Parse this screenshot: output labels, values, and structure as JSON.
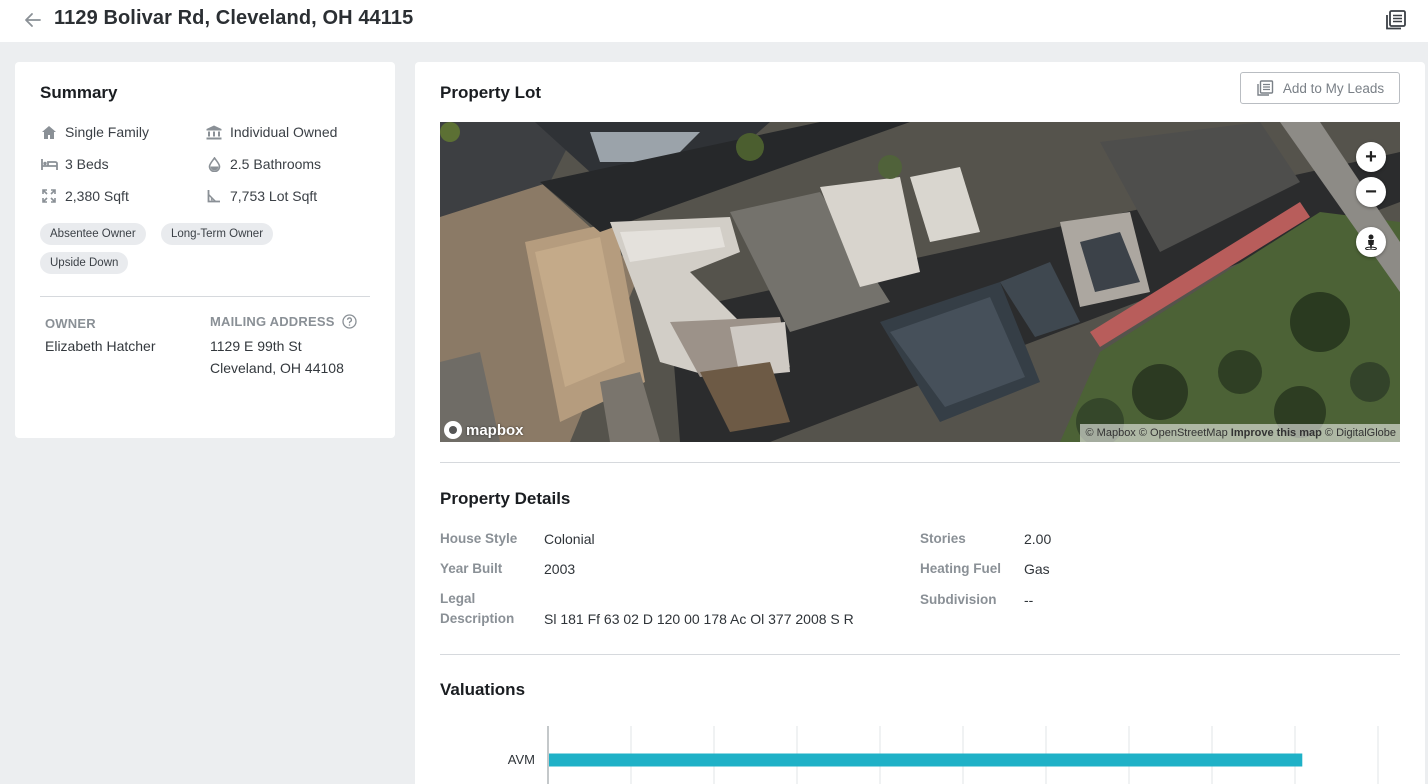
{
  "header": {
    "title": "1129 Bolivar Rd, Cleveland, OH 44115"
  },
  "summary": {
    "title": "Summary",
    "features": [
      {
        "icon": "home-icon",
        "label": "Single Family"
      },
      {
        "icon": "bank-icon",
        "label": "Individual Owned"
      },
      {
        "icon": "bed-icon",
        "label": "3 Beds"
      },
      {
        "icon": "water-drop-icon",
        "label": "2.5 Bathrooms"
      },
      {
        "icon": "expand-icon",
        "label": "2,380 Sqft"
      },
      {
        "icon": "lot-angle-icon",
        "label": "7,753 Lot Sqft"
      }
    ],
    "tags": [
      "Absentee Owner",
      "Long-Term Owner",
      "Upside Down"
    ],
    "owner_label": "OWNER",
    "owner_name": "Elizabeth Hatcher",
    "mailing_label": "MAILING ADDRESS",
    "mailing_line1": "1129 E 99th St",
    "mailing_line2": "Cleveland, OH 44108"
  },
  "property_lot": {
    "title": "Property Lot",
    "add_leads_label": "Add to My Leads",
    "map": {
      "brand": "mapbox",
      "attribution_mapbox": "© Mapbox",
      "attribution_osm": "© OpenStreetMap",
      "attribution_improve": "Improve this map",
      "attribution_dg": "© DigitalGlobe",
      "zoom_in": "+",
      "zoom_out": "−"
    }
  },
  "property_details": {
    "title": "Property Details",
    "left": [
      {
        "label": "House Style",
        "value": "Colonial"
      },
      {
        "label": "Year Built",
        "value": "2003"
      },
      {
        "label": "Legal Description",
        "value": "Sl 181 Ff 63 02 D 120 00 178 Ac Ol 377 2008 S R"
      }
    ],
    "right": [
      {
        "label": "Stories",
        "value": "2.00"
      },
      {
        "label": "Heating Fuel",
        "value": "Gas"
      },
      {
        "label": "Subdivision",
        "value": "--"
      }
    ]
  },
  "valuations": {
    "title": "Valuations"
  },
  "chart_data": {
    "type": "bar",
    "orientation": "horizontal",
    "categories": [
      "AVM"
    ],
    "values": [
      87
    ],
    "xlim": [
      0,
      100
    ],
    "grid": true,
    "color": "#1fb1c7"
  }
}
